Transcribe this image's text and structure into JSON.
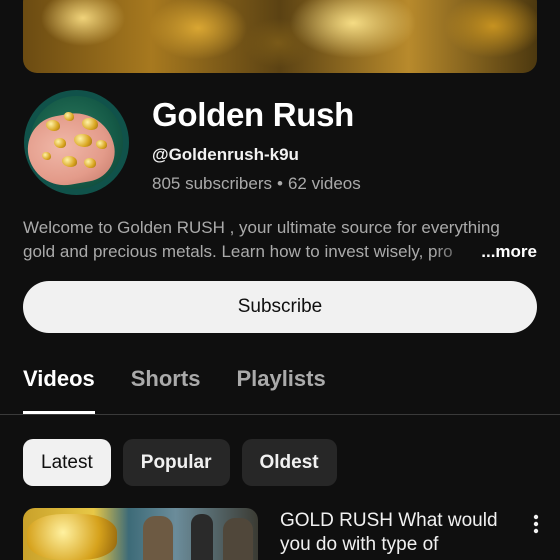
{
  "channel": {
    "name": "Golden Rush",
    "handle": "@Goldenrush-k9u",
    "subscribers": "805 subscribers",
    "separator": "•",
    "videos": "62 videos",
    "description_line1": "Welcome to Golden RUSH , your ultimate source for everything",
    "description_line2": "gold and precious metals. Learn how to invest wisely, pro",
    "more_label": "...more"
  },
  "subscribe_label": "Subscribe",
  "tabs": [
    {
      "label": "Videos",
      "active": true
    },
    {
      "label": "Shorts",
      "active": false
    },
    {
      "label": "Playlists",
      "active": false
    }
  ],
  "chips": [
    {
      "label": "Latest",
      "selected": true
    },
    {
      "label": "Popular",
      "selected": false
    },
    {
      "label": "Oldest",
      "selected": false
    }
  ],
  "video": {
    "title": "GOLD RUSH What would you do with type of"
  },
  "icons": {
    "more_actions": "more-vertical-icon"
  },
  "colors": {
    "background": "#0f0f0f",
    "chip_bg": "#272727",
    "button_bg": "#f1f1f1",
    "secondary_text": "#aaaaaa"
  }
}
